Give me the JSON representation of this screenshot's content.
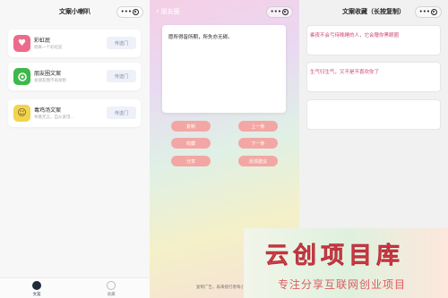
{
  "panel1": {
    "title": "文案小喇叭",
    "cards": [
      {
        "title": "彩虹屁",
        "subtitle": "刚来一个彩虹屁",
        "button": "传送门",
        "icon": "heart-icon",
        "icon_color": "#ec6b8b"
      },
      {
        "title": "朋友圈文案",
        "subtitle": "发朋友圈不再发愁",
        "button": "传送门",
        "icon": "camera-icon",
        "icon_color": "#3eb84a"
      },
      {
        "title": "毒鸡汤文案",
        "subtitle": "举箸无言，自从爱惜…",
        "button": "传送门",
        "icon": "face-icon",
        "icon_color": "#f1d54e"
      }
    ],
    "tabs": [
      {
        "label": "文案",
        "icon": "home-icon",
        "active": true
      },
      {
        "label": "收藏",
        "icon": "bookmark-icon",
        "active": false
      }
    ]
  },
  "panel2": {
    "back_label": "朋友圈",
    "quote": "愿所得皆所期，所失亦无碍。",
    "buttons": {
      "copy": "复制",
      "prev": "上一条",
      "collect": "收藏",
      "next": "下一条",
      "share": "分享",
      "feedback": "反馈建议"
    },
    "ad_text": "复制广告，再来接打者每小程序"
  },
  "panel3": {
    "title": "文案收藏（长按复制）",
    "items": [
      {
        "text": "乘夜不会亏待晚睡的人，它会赠你黑眼圈"
      },
      {
        "text": "生气归生气，又不是不喜欢你了"
      },
      {
        "text": ""
      }
    ]
  },
  "watermark": {
    "title": "云创项目库",
    "subtitle": "专注分享互联网创业项目"
  },
  "colors": {
    "accent_pink": "#f3a7a4",
    "fav_text": "#d1457a",
    "watermark_red": "#e64c56"
  }
}
